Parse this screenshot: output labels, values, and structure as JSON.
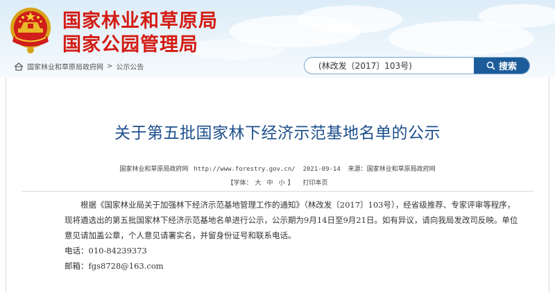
{
  "header": {
    "site_name_line1": "国家林业和草原局",
    "site_name_line2": "国家公园管理局",
    "brand_color": "#d41c14"
  },
  "breadcrumb": {
    "home_label": "国家林业和草原局政府网",
    "separator": ">",
    "current": "公示公告"
  },
  "search": {
    "value": "(林改发〔2017〕103号)",
    "button_label": "搜索"
  },
  "article": {
    "title": "关于第五批国家林下经济示范基地名单的公示",
    "source": "国家林业和草原局政府网",
    "url": "http://www.forestry.gov.cn/",
    "date": "2021-09-14",
    "origin_label": "来源：国家林业和草原局政府网",
    "font_prefix": "【字体：",
    "font_large": "大",
    "font_medium": "中",
    "font_small": "小",
    "font_suffix": "】",
    "print_label": "打印本页",
    "body": "根据《国家林业局关于加强林下经济示范基地管理工作的通知》（林改发〔2017〕103号），经省级推荐、专家评审等程序，现将遴选出的第五批国家林下经济示范基地名单进行公示，公示期为9月14日至9月21日。如有异议，请向我局发改司反映。单位意见请加盖公章，个人意见请署实名，并留身份证号和联系电话。",
    "phone": "电话：010-84239373",
    "email": "邮箱：fgs8728@163.com"
  }
}
